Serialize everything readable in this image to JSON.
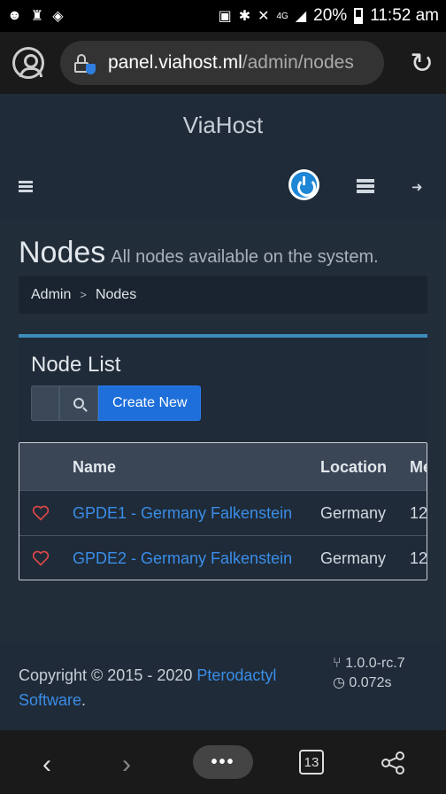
{
  "status_bar": {
    "battery": "20%",
    "time": "11:52 am",
    "network": "4G"
  },
  "browser": {
    "url_host": "panel.viahost.ml",
    "url_path": "/admin/nodes",
    "tabs_count": "13",
    "menu_label": "•••"
  },
  "app": {
    "brand": "ViaHost"
  },
  "page": {
    "title": "Nodes",
    "subtitle": "All nodes available on the system."
  },
  "breadcrumb": {
    "items": [
      "Admin",
      "Nodes"
    ],
    "separator": ">"
  },
  "panel": {
    "title": "Node List",
    "create_label": "Create New"
  },
  "table": {
    "columns": [
      "Name",
      "Location",
      "Memory"
    ],
    "rows": [
      {
        "name": "GPDE1 - Germany Falkenstein",
        "location": "Germany",
        "memory": "12"
      },
      {
        "name": "GPDE2 - Germany Falkenstein",
        "location": "Germany",
        "memory": "12"
      }
    ]
  },
  "footer": {
    "copyright_prefix": "Copyright © 2015 - 2020 ",
    "copyright_link": "Pterodactyl Software",
    "copyright_suffix": ".",
    "version": "1.0.0-rc.7",
    "time": "0.072s"
  },
  "colors": {
    "accent": "#3c8dbc",
    "link": "#3a8de8",
    "primary_button": "#1e6fd9",
    "heart": "#e04848"
  }
}
